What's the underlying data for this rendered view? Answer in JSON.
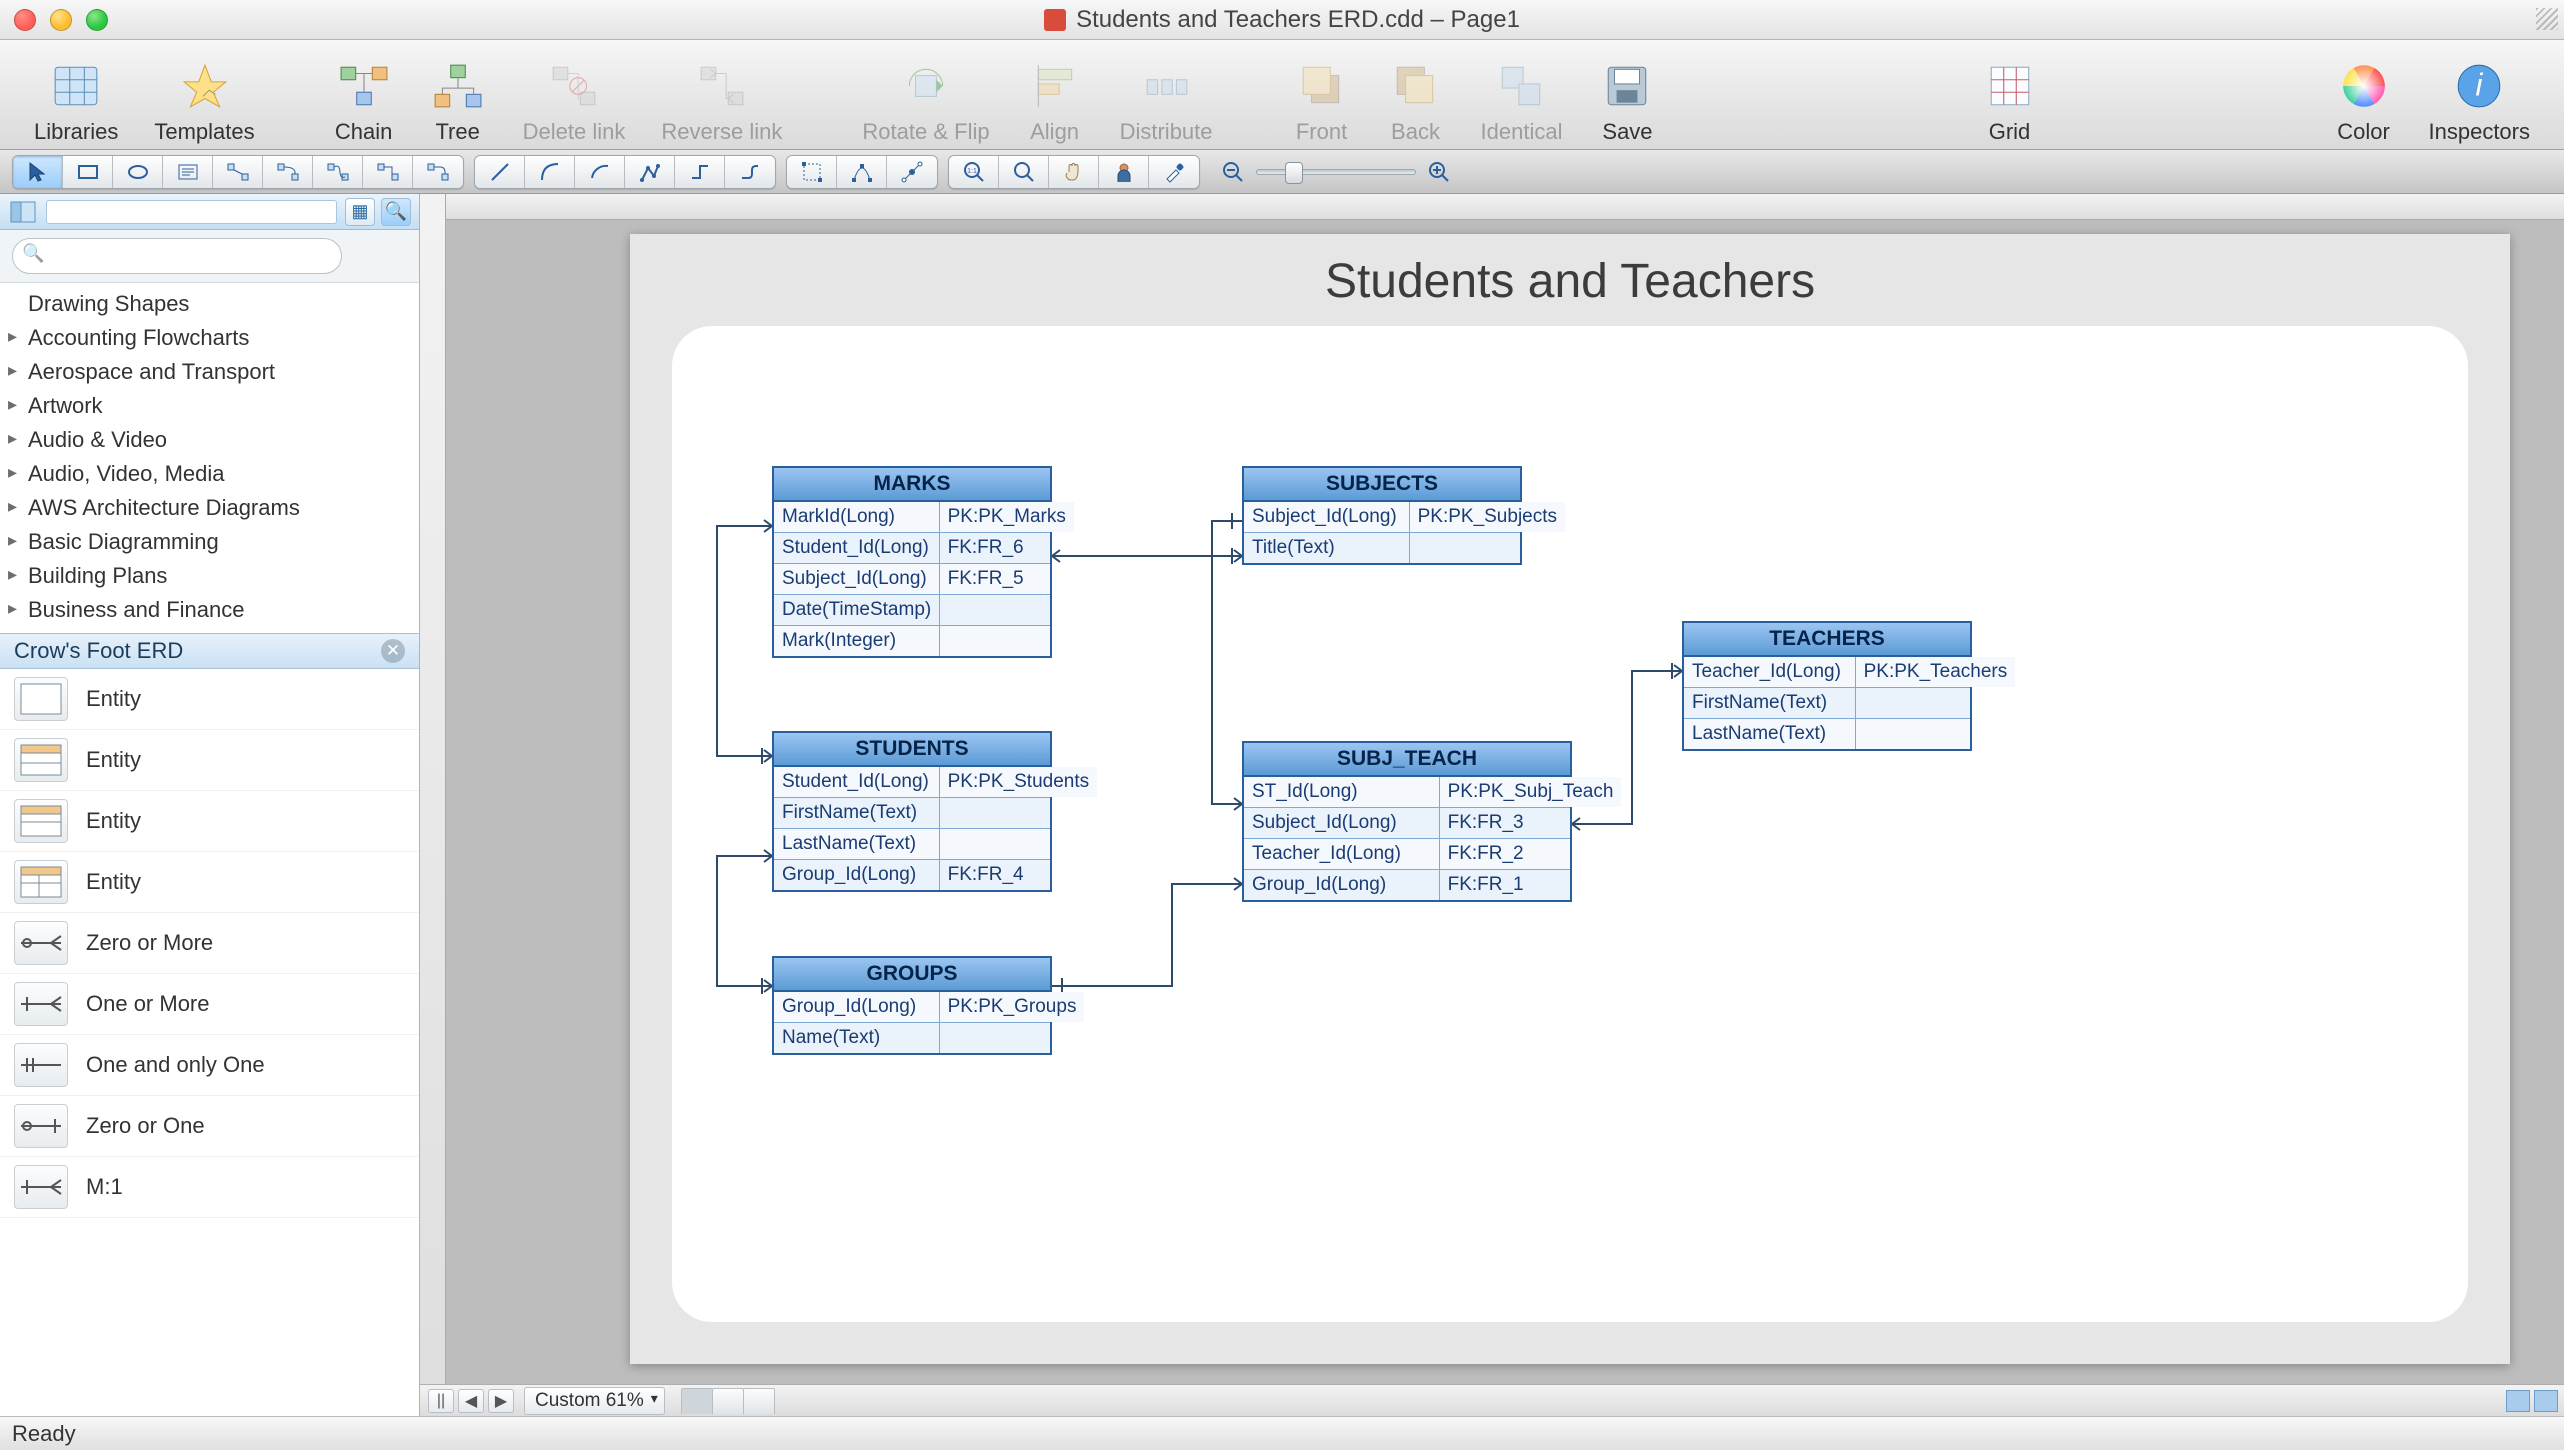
{
  "window": {
    "title": "Students and Teachers ERD.cdd – Page1"
  },
  "toolbar": {
    "libraries": "Libraries",
    "templates": "Templates",
    "chain": "Chain",
    "tree": "Tree",
    "delete_link": "Delete link",
    "reverse_link": "Reverse link",
    "rotate_flip": "Rotate & Flip",
    "align": "Align",
    "distribute": "Distribute",
    "front": "Front",
    "back": "Back",
    "identical": "Identical",
    "save": "Save",
    "grid": "Grid",
    "color": "Color",
    "inspectors": "Inspectors"
  },
  "sidebar": {
    "search_placeholder": "",
    "tree_root": "Drawing Shapes",
    "categories": [
      "Accounting Flowcharts",
      "Aerospace and Transport",
      "Artwork",
      "Audio & Video",
      "Audio, Video, Media",
      "AWS Architecture Diagrams",
      "Basic Diagramming",
      "Building Plans",
      "Business and Finance"
    ],
    "active_section": "Crow's Foot ERD",
    "shapes": [
      {
        "name": "Entity",
        "icon": "entity-simple"
      },
      {
        "name": "Entity",
        "icon": "entity-hdr"
      },
      {
        "name": "Entity",
        "icon": "entity-hdr-col"
      },
      {
        "name": "Entity",
        "icon": "entity-full"
      },
      {
        "name": "Zero or More",
        "icon": "rel-zom"
      },
      {
        "name": "One or More",
        "icon": "rel-oom"
      },
      {
        "name": "One and only One",
        "icon": "rel-one"
      },
      {
        "name": "Zero or One",
        "icon": "rel-zoo"
      },
      {
        "name": "M:1",
        "icon": "rel-m1"
      }
    ]
  },
  "canvas": {
    "title": "Students and Teachers",
    "entities": {
      "marks": {
        "title": "MARKS",
        "rows": [
          {
            "c1": "MarkId(Long)",
            "c2": "PK:PK_Marks"
          },
          {
            "c1": "Student_Id(Long)",
            "c2": "FK:FR_6"
          },
          {
            "c1": "Subject_Id(Long)",
            "c2": "FK:FR_5"
          },
          {
            "c1": "Date(TimeStamp)",
            "c2": ""
          },
          {
            "c1": "Mark(Integer)",
            "c2": ""
          }
        ]
      },
      "subjects": {
        "title": "SUBJECTS",
        "rows": [
          {
            "c1": "Subject_Id(Long)",
            "c2": "PK:PK_Subjects"
          },
          {
            "c1": "Title(Text)",
            "c2": ""
          }
        ]
      },
      "students": {
        "title": "STUDENTS",
        "rows": [
          {
            "c1": "Student_Id(Long)",
            "c2": "PK:PK_Students"
          },
          {
            "c1": "FirstName(Text)",
            "c2": ""
          },
          {
            "c1": "LastName(Text)",
            "c2": ""
          },
          {
            "c1": "Group_Id(Long)",
            "c2": "FK:FR_4"
          }
        ]
      },
      "subj_teach": {
        "title": "SUBJ_TEACH",
        "rows": [
          {
            "c1": "ST_Id(Long)",
            "c2": "PK:PK_Subj_Teach"
          },
          {
            "c1": "Subject_Id(Long)",
            "c2": "FK:FR_3"
          },
          {
            "c1": "Teacher_Id(Long)",
            "c2": "FK:FR_2"
          },
          {
            "c1": "Group_Id(Long)",
            "c2": "FK:FR_1"
          }
        ]
      },
      "teachers": {
        "title": "TEACHERS",
        "rows": [
          {
            "c1": "Teacher_Id(Long)",
            "c2": "PK:PK_Teachers"
          },
          {
            "c1": "FirstName(Text)",
            "c2": ""
          },
          {
            "c1": "LastName(Text)",
            "c2": ""
          }
        ]
      },
      "groups": {
        "title": "GROUPS",
        "rows": [
          {
            "c1": "Group_Id(Long)",
            "c2": "PK:PK_Groups"
          },
          {
            "c1": "Name(Text)",
            "c2": ""
          }
        ]
      }
    },
    "zoom_label": "Custom 61%"
  },
  "status": {
    "text": "Ready"
  }
}
